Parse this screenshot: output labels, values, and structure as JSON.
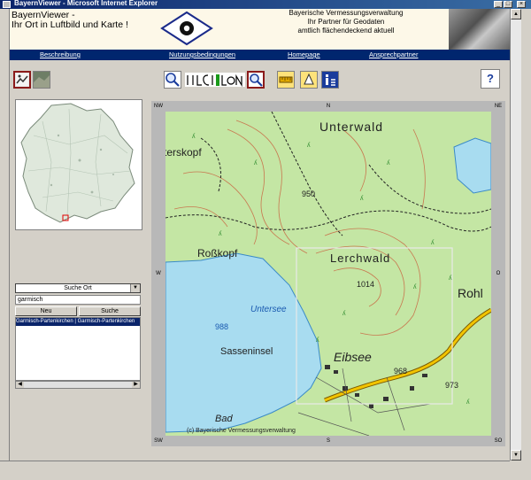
{
  "window": {
    "title": "BayernViewer - Microsoft Internet Explorer"
  },
  "banner": {
    "title_line1": "BayernViewer -",
    "title_line2": "Ihr Ort in Luftbild und Karte !",
    "agency_line1": "Bayerische Vermessungsverwaltung",
    "agency_line2": "Ihr Partner für Geodaten",
    "agency_line3": "amtlich   flächendeckend   aktuell"
  },
  "nav": {
    "items": [
      "Beschreibung",
      "Nutzungsbedingungen",
      "Homepage",
      "Ansprechpartner"
    ]
  },
  "toolbar": {
    "help_label": "?"
  },
  "search": {
    "selected_option": "Suche Ort",
    "input_value": "garmisch",
    "new_label": "Neu",
    "search_label": "Suche",
    "result_selected": "Garmisch-Partenkirchen | Garmisch-Partenkirchen"
  },
  "map": {
    "edges": {
      "nw": "NW",
      "n": "N",
      "ne": "NE",
      "w": "W",
      "e": "O",
      "sw": "SW",
      "s": "S",
      "se": "SO"
    },
    "labels": {
      "unterwald": "Unterwald",
      "terskopf": "terskopf",
      "elev950": "950",
      "rosskopf": "Roßkopf",
      "lerchwald": "Lerchwald",
      "elev1014": "1014",
      "rohl": "Rohl",
      "untersee": "Untersee",
      "elev988": "988",
      "sasseninsel": "Sasseninsel",
      "eibsee": "Eibsee",
      "elev968": "968",
      "elev973": "973",
      "bad": "Bad"
    },
    "copyright": "(c) Bayerische Vermessungsverwaltung",
    "colors": {
      "forest": "#c4e6a4",
      "lake": "#a8dcf0",
      "road": "#f2c400"
    }
  }
}
